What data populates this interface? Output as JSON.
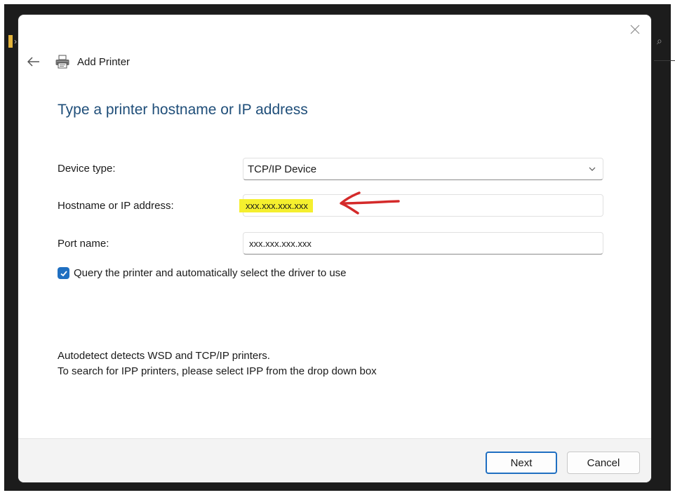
{
  "window": {
    "title": "Add Printer"
  },
  "page": {
    "heading": "Type a printer hostname or IP address"
  },
  "form": {
    "device_type": {
      "label": "Device type:",
      "value": "TCP/IP Device"
    },
    "hostname": {
      "label": "Hostname or IP address:",
      "value": "xxx.xxx.xxx.xxx"
    },
    "port": {
      "label": "Port name:",
      "value": "xxx.xxx.xxx.xxx"
    },
    "query": {
      "label": "Query the printer and automatically select the driver to use",
      "checked": true
    }
  },
  "info": {
    "line1": "Autodetect detects WSD and TCP/IP printers.",
    "line2": "To search for IPP printers, please select IPP from the drop down box"
  },
  "buttons": {
    "next": "Next",
    "cancel": "Cancel"
  },
  "colors": {
    "accent": "#1f6fc1",
    "heading": "#1f4e79",
    "highlight": "#f5ef2e",
    "annotation": "#d42a2a"
  },
  "icons": [
    "close-icon",
    "back-arrow-icon",
    "printer-icon",
    "chevron-down-icon",
    "checkmark-icon"
  ]
}
